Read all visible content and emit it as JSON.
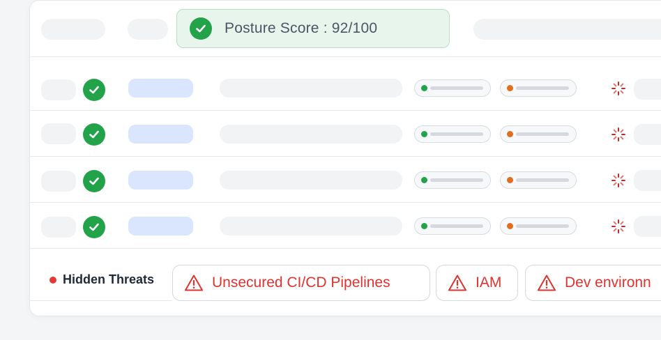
{
  "posture": {
    "label": "Posture Score : 92/100"
  },
  "threats": {
    "title": "Hidden Threats",
    "chips": [
      {
        "label": "Unsecured CI/CD Pipelines",
        "icon": "warning-icon"
      },
      {
        "label": "IAM",
        "icon": "warning-icon"
      },
      {
        "label": "Dev environn",
        "icon": "warning-icon"
      }
    ]
  },
  "rows": [
    {
      "status": "check-icon",
      "tag1_color": "#22a34a",
      "tag2_color": "#e26d1d",
      "activity": "spinner-icon"
    },
    {
      "status": "check-icon",
      "tag1_color": "#22a34a",
      "tag2_color": "#e26d1d",
      "activity": "spinner-icon"
    },
    {
      "status": "check-icon",
      "tag1_color": "#22a34a",
      "tag2_color": "#e26d1d",
      "activity": "spinner-icon"
    },
    {
      "status": "check-icon",
      "tag1_color": "#22a34a",
      "tag2_color": "#e26d1d",
      "activity": "spinner-icon"
    }
  ],
  "colors": {
    "success": "#22a34a",
    "warning": "#e26d1d",
    "danger": "#e0322f",
    "highlight_bg": "#e8f5ec",
    "blue_pill": "#d9e6fd"
  }
}
